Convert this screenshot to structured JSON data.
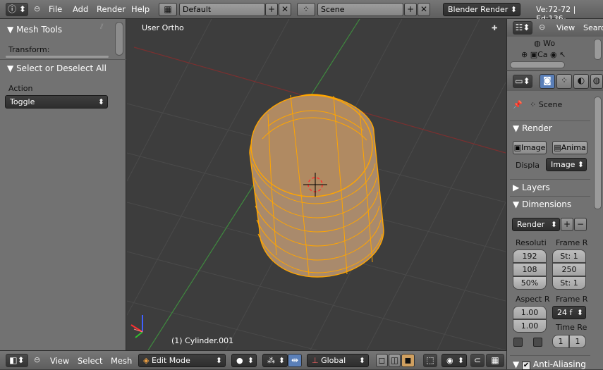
{
  "topbar": {
    "menus": [
      "File",
      "Add",
      "Render",
      "Help"
    ],
    "layout_name": "Default",
    "scene_name": "Scene",
    "engine": "Blender Render",
    "stats": "Ve:72-72 | Ed:136-"
  },
  "left": {
    "mesh_tools": "Mesh Tools",
    "transform": "Transform:",
    "select_panel": "Select or Deselect All",
    "action_label": "Action",
    "action_value": "Toggle"
  },
  "viewport": {
    "view_label": "User Ortho",
    "object_label": "(1) Cylinder.001"
  },
  "outliner": {
    "view": "View",
    "search": "Searc",
    "item1": "Wo",
    "item2": "Ca"
  },
  "props": {
    "scene": "Scene",
    "render_panel": "Render",
    "image_btn": "Image",
    "anim_btn": "Anima",
    "display_label": "Displa",
    "display_value": "Image",
    "layers_panel": "Layers",
    "dimensions_panel": "Dimensions",
    "preset": "Render",
    "resolution_label": "Resoluti",
    "res_x": "192",
    "res_y": "108",
    "res_pct": "50%",
    "frame_range_label": "Frame R",
    "frame_start": "St: 1",
    "frame_end": "250",
    "frame_step": "St: 1",
    "aspect_label": "Aspect R",
    "aspect_x": "1.00",
    "aspect_y": "1.00",
    "frame_rate_label": "Frame R",
    "frame_rate": "24 f",
    "time_remap_label": "Time Re",
    "time_old": "1",
    "time_new": "1",
    "aa_panel": "Anti-Aliasing"
  },
  "bottombar": {
    "view": "View",
    "select": "Select",
    "mesh": "Mesh",
    "mode": "Edit Mode",
    "orientation": "Global"
  },
  "colors": {
    "mesh_edge": "#ffa500",
    "mesh_face": "#b08a62",
    "grid_x": "#8a3a3a",
    "grid_y": "#3f8a3f"
  }
}
